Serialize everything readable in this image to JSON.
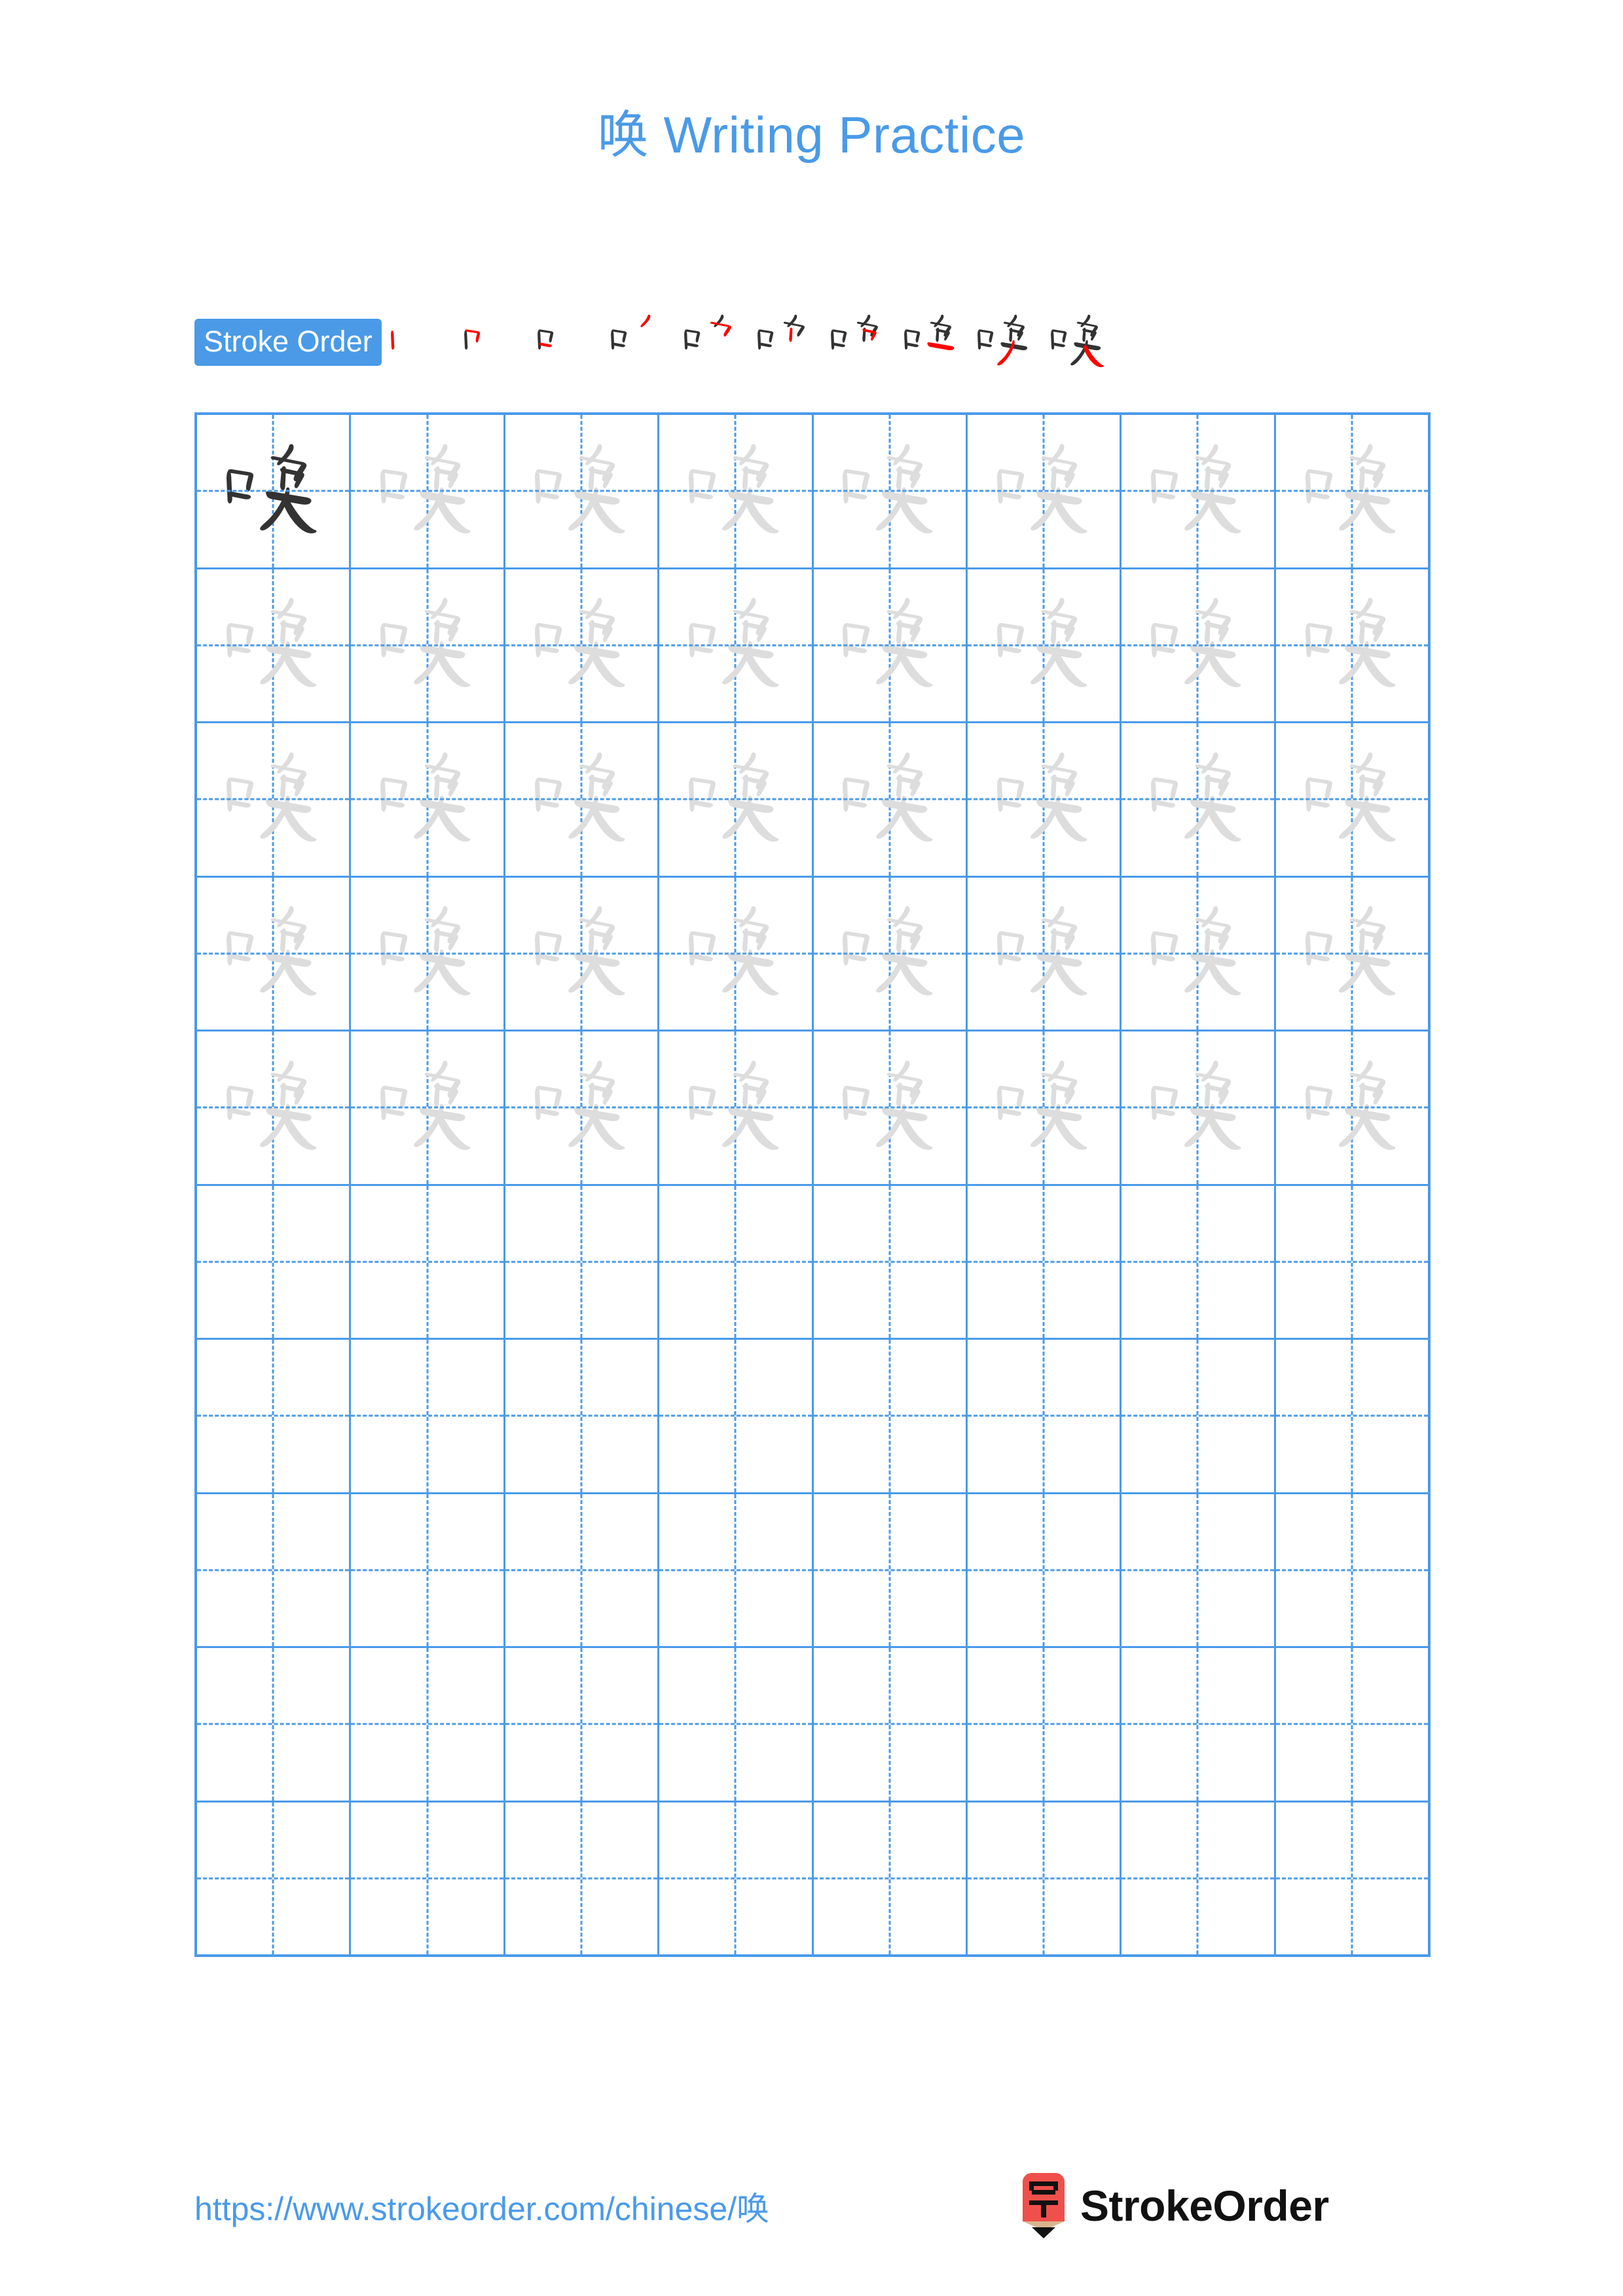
{
  "page": {
    "character": "唤",
    "title": "唤 Writing Practice",
    "title_character": "唤",
    "title_text": " Writing Practice",
    "background_color": "#ffffff",
    "accent_color": "#4a9ae8",
    "new_stroke_color": "#ff0000",
    "done_stroke_color": "#333333",
    "trace_color": "#dddddd"
  },
  "stroke_order": {
    "badge_label": "Stroke Order",
    "total_strokes": 10,
    "steps": [
      {
        "index": 1,
        "new_stroke": "丨",
        "cumulative": "丨"
      },
      {
        "index": 2,
        "new_stroke": "𠃌",
        "cumulative": "冂"
      },
      {
        "index": 3,
        "new_stroke": "一",
        "cumulative": "口"
      },
      {
        "index": 4,
        "new_stroke": "丿",
        "cumulative": "口丿"
      },
      {
        "index": 5,
        "new_stroke": "㇓",
        "cumulative": "口⺈"
      },
      {
        "index": 6,
        "new_stroke": "丨",
        "cumulative": "口⺈丨"
      },
      {
        "index": 7,
        "new_stroke": "𠃍",
        "cumulative": "口⺈㇆"
      },
      {
        "index": 8,
        "new_stroke": "一",
        "cumulative": "口⺈㇆一"
      },
      {
        "index": 9,
        "new_stroke": "丿",
        "cumulative": "口免(部分)"
      },
      {
        "index": 10,
        "new_stroke": "㇟",
        "cumulative": "唤"
      }
    ]
  },
  "practice_grid": {
    "columns": 8,
    "rows": 10,
    "rows_data": [
      {
        "row": 1,
        "cells": [
          "dark",
          "light",
          "light",
          "light",
          "light",
          "light",
          "light",
          "light"
        ]
      },
      {
        "row": 2,
        "cells": [
          "light",
          "light",
          "light",
          "light",
          "light",
          "light",
          "light",
          "light"
        ]
      },
      {
        "row": 3,
        "cells": [
          "light",
          "light",
          "light",
          "light",
          "light",
          "light",
          "light",
          "light"
        ]
      },
      {
        "row": 4,
        "cells": [
          "light",
          "light",
          "light",
          "light",
          "light",
          "light",
          "light",
          "light"
        ]
      },
      {
        "row": 5,
        "cells": [
          "light",
          "light",
          "light",
          "light",
          "light",
          "light",
          "light",
          "light"
        ]
      },
      {
        "row": 6,
        "cells": [
          "empty",
          "empty",
          "empty",
          "empty",
          "empty",
          "empty",
          "empty",
          "empty"
        ]
      },
      {
        "row": 7,
        "cells": [
          "empty",
          "empty",
          "empty",
          "empty",
          "empty",
          "empty",
          "empty",
          "empty"
        ]
      },
      {
        "row": 8,
        "cells": [
          "empty",
          "empty",
          "empty",
          "empty",
          "empty",
          "empty",
          "empty",
          "empty"
        ]
      },
      {
        "row": 9,
        "cells": [
          "empty",
          "empty",
          "empty",
          "empty",
          "empty",
          "empty",
          "empty",
          "empty"
        ]
      },
      {
        "row": 10,
        "cells": [
          "empty",
          "empty",
          "empty",
          "empty",
          "empty",
          "empty",
          "empty",
          "empty"
        ]
      }
    ]
  },
  "footer": {
    "url": "https://www.strokeorder.com/chinese/唤",
    "brand_name": "StrokeOrder",
    "logo_glyph": "字",
    "logo_body_color": "#f0504b",
    "logo_wood_color": "#d9b68d"
  }
}
